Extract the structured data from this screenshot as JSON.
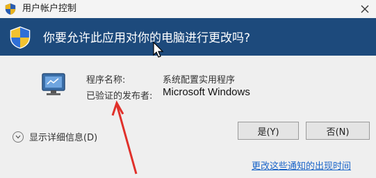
{
  "window": {
    "title": "用户帐户控制"
  },
  "header": {
    "question": "你要允许此应用对你的电脑进行更改吗?"
  },
  "info": {
    "program_label": "程序名称:",
    "program_value": "系统配置实用程序",
    "publisher_label": "已验证的发布者:",
    "publisher_value": "Microsoft Windows"
  },
  "details": {
    "label": "显示详细信息(D)"
  },
  "buttons": {
    "yes_label": "是(Y)",
    "no_label": "否(N)"
  },
  "link": {
    "label": "更改这些通知的出现时间"
  },
  "colors": {
    "header_bg": "#1d4a7c",
    "link": "#1a64c8",
    "annotation_arrow": "#e0302a"
  },
  "icons": [
    "uac-shield-icon",
    "close-icon",
    "computer-monitor-icon",
    "chevron-down-icon",
    "mouse-cursor-icon"
  ]
}
